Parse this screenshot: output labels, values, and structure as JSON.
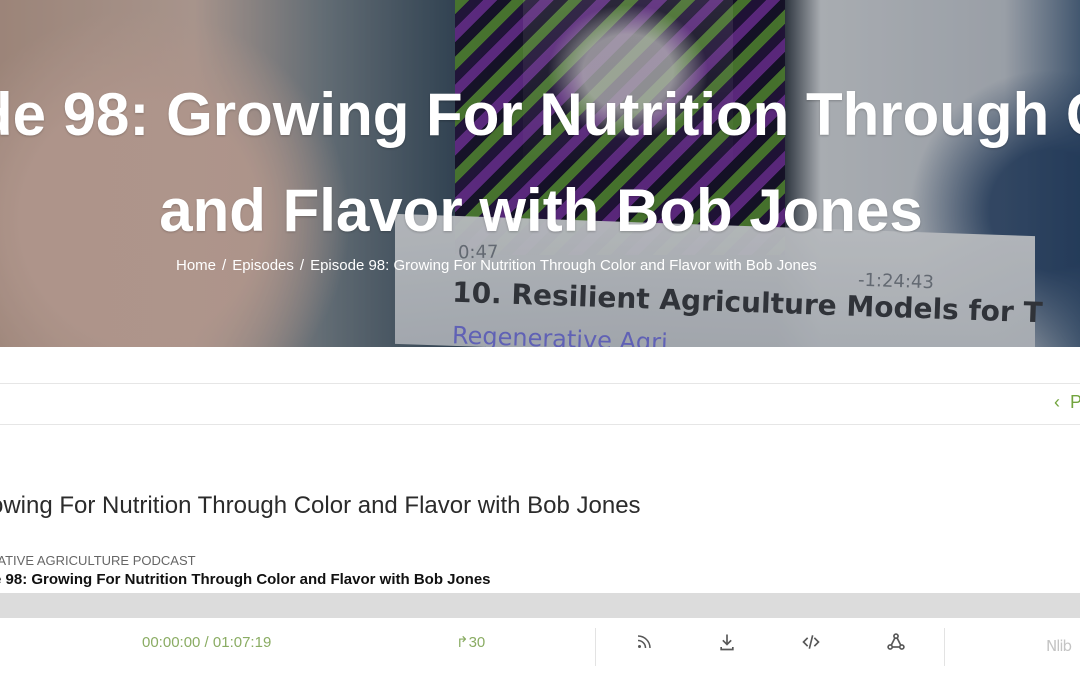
{
  "hero": {
    "title_line1": "de 98: Growing For Nutrition Through C",
    "title_line2": "and Flavor with Bob Jones",
    "breadcrumb": {
      "home": "Home",
      "sep1": "/",
      "episodes": "Episodes",
      "sep2": "/",
      "current": "Episode 98: Growing For Nutrition Through Color and Flavor with Bob Jones"
    },
    "background": {
      "time_left": "0:47",
      "time_right": "-1:24:43",
      "screen_title": "10. Resilient Agriculture Models for T",
      "screen_subtitle": "Regenerative Agri"
    }
  },
  "navigation": {
    "prev_icon": "chevron-left-icon",
    "prev_label": "P"
  },
  "content": {
    "title": "owing For Nutrition Through Color and Flavor with Bob Jones",
    "podcast_name": "RATIVE AGRICULTURE PODCAST",
    "episode_title": "e 98: Growing For Nutrition Through Color and Flavor with Bob Jones"
  },
  "player": {
    "time": "00:00:00 / 01:07:19",
    "skip_label": "↱30",
    "icons": {
      "rss": "rss-icon",
      "download": "download-icon",
      "embed": "embed-icon",
      "share": "share-icon"
    },
    "brand_mark": "Nlib"
  },
  "colors": {
    "accent_green": "#72a43e",
    "player_green": "#8aac63",
    "player_bar": "#dcdcdc"
  }
}
